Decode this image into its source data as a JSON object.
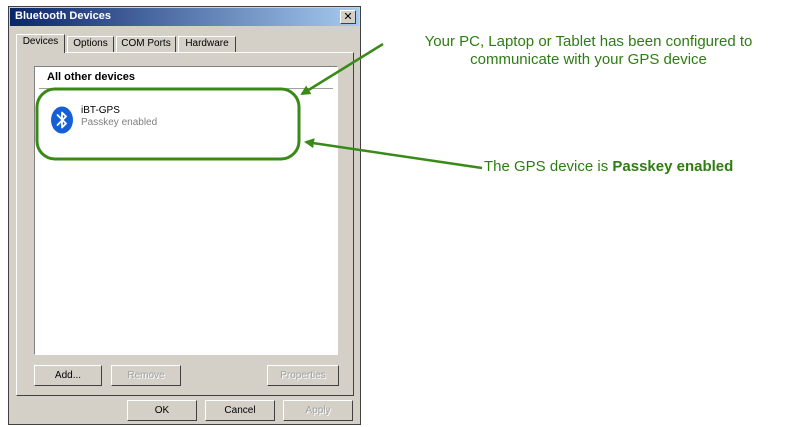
{
  "window": {
    "title": "Bluetooth Devices",
    "close_glyph": "✕"
  },
  "tabs": [
    {
      "label": "Devices",
      "active": true
    },
    {
      "label": "Options",
      "active": false
    },
    {
      "label": "COM Ports",
      "active": false
    },
    {
      "label": "Hardware",
      "active": false
    }
  ],
  "device_list": {
    "group_header": "All other devices",
    "devices": [
      {
        "name": "iBT-GPS",
        "status": "Passkey enabled",
        "icon": "bluetooth-icon"
      }
    ]
  },
  "panel_buttons": {
    "add": "Add...",
    "remove": "Remove",
    "properties": "Properties"
  },
  "dialog_buttons": {
    "ok": "OK",
    "cancel": "Cancel",
    "apply": "Apply"
  },
  "annotations": {
    "configured_line1": "Your PC, Laptop or Tablet has been configured to",
    "configured_line2": "communicate with your GPS device",
    "passkey_prefix": "The GPS device is ",
    "passkey_bold": "Passkey enabled"
  },
  "colors": {
    "annotation_green": "#2e7d12",
    "bluetooth_blue": "#1560d6"
  }
}
